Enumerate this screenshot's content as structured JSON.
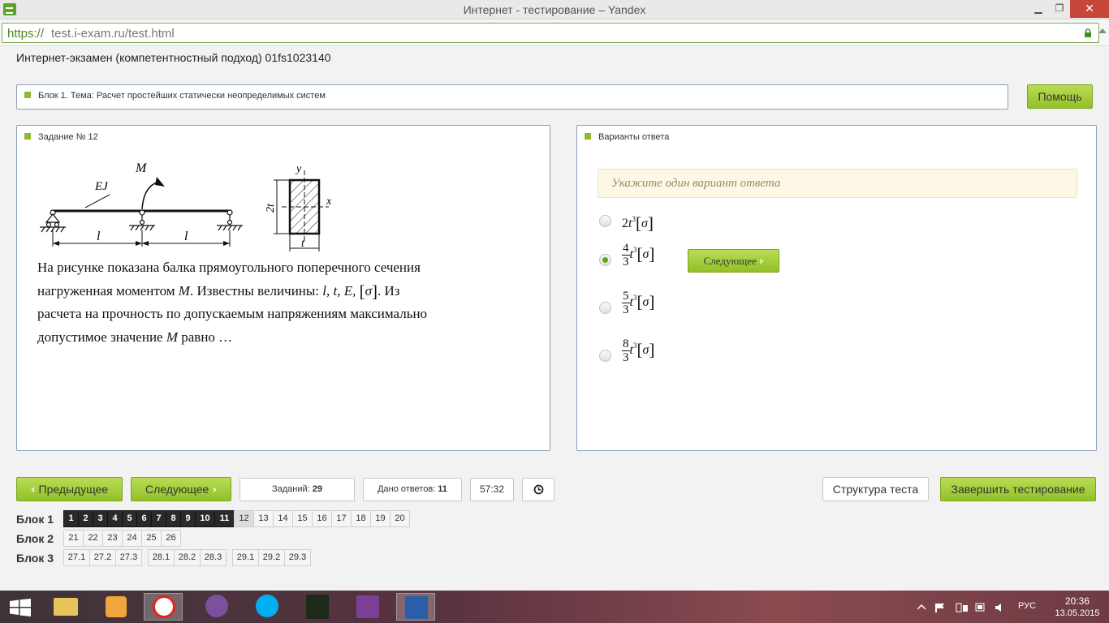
{
  "window": {
    "title": "Интернет - тестирование – Yandex",
    "min_icon": "minimize-icon",
    "max_icon": "restore-icon",
    "close_icon": "close-icon"
  },
  "address": {
    "scheme": "https://",
    "host_path": "test.i-exam.ru/test.html"
  },
  "exam": {
    "title": "Интернет-экзамен (компетентностный подход) 01fs1023140"
  },
  "topic": {
    "label": "Блок 1. Тема: Расчет простейших статически неопределимых систем"
  },
  "help_label": "Помощь",
  "task": {
    "header": "Задание № 12",
    "figure": {
      "ej": "EJ",
      "moment": "M",
      "span1": "l",
      "span2": "l",
      "axis_y": "y",
      "axis_x": "x",
      "height": "2t",
      "width": "t"
    },
    "text_line1": "На рисунке показана балка прямоугольного поперечного сечения",
    "text_line2a": "нагруженная моментом",
    "text_M": "M",
    "text_line2b": ". Известны величины:",
    "text_vars": "l, t, E,",
    "text_sigma": "σ",
    "text_line2c": ". Из",
    "text_line3": "расчета на прочность по допускаемым напряжениям максимально",
    "text_line4a": "допустимое значение",
    "text_M2": "M",
    "text_line4b": "равно …"
  },
  "answers": {
    "header": "Варианты ответа",
    "hint": "Укажите один вариант ответа",
    "options": [
      {
        "coef": "2",
        "num": "",
        "den": "",
        "var": "t",
        "pow": "3",
        "sigma": "σ",
        "selected": false
      },
      {
        "coef": "",
        "num": "4",
        "den": "3",
        "var": "t",
        "pow": "3",
        "sigma": "σ",
        "selected": true
      },
      {
        "coef": "",
        "num": "5",
        "den": "3",
        "var": "t",
        "pow": "3",
        "sigma": "σ",
        "selected": false
      },
      {
        "coef": "",
        "num": "8",
        "den": "3",
        "var": "t",
        "pow": "3",
        "sigma": "σ",
        "selected": false
      }
    ],
    "next_inline_label": "Следующее"
  },
  "nav": {
    "prev_label": "Предыдущее",
    "next_label": "Следующее",
    "tasks_label": "Заданий:",
    "tasks_value": "29",
    "answered_label": "Дано ответов:",
    "answered_value": "11",
    "timer": "57:32",
    "structure_label": "Структура теста",
    "finish_label": "Завершить тестирование"
  },
  "blocks": [
    {
      "label": "Блок 1",
      "groups": [
        [
          "1",
          "2",
          "3",
          "4",
          "5",
          "6",
          "7",
          "8",
          "9",
          "10",
          "11",
          "12",
          "13",
          "14",
          "15",
          "16",
          "17",
          "18",
          "19",
          "20"
        ]
      ]
    },
    {
      "label": "Блок 2",
      "groups": [
        [
          "21",
          "22",
          "23",
          "24",
          "25",
          "26"
        ]
      ]
    },
    {
      "label": "Блок 3",
      "groups": [
        [
          "27.1",
          "27.2",
          "27.3"
        ],
        [
          "28.1",
          "28.2",
          "28.3"
        ],
        [
          "29.1",
          "29.2",
          "29.3"
        ]
      ]
    }
  ],
  "answered_tasks": 11,
  "current_task": "12",
  "taskbar": {
    "apps": [
      "file-explorer-icon",
      "2gis-icon",
      "yandex-browser-icon",
      "viber-icon",
      "skype-icon",
      "galaxy-game-icon",
      "onenote-icon",
      "word-icon"
    ],
    "lang": "РУС",
    "time": "20:36",
    "date": "13.05.2015"
  }
}
